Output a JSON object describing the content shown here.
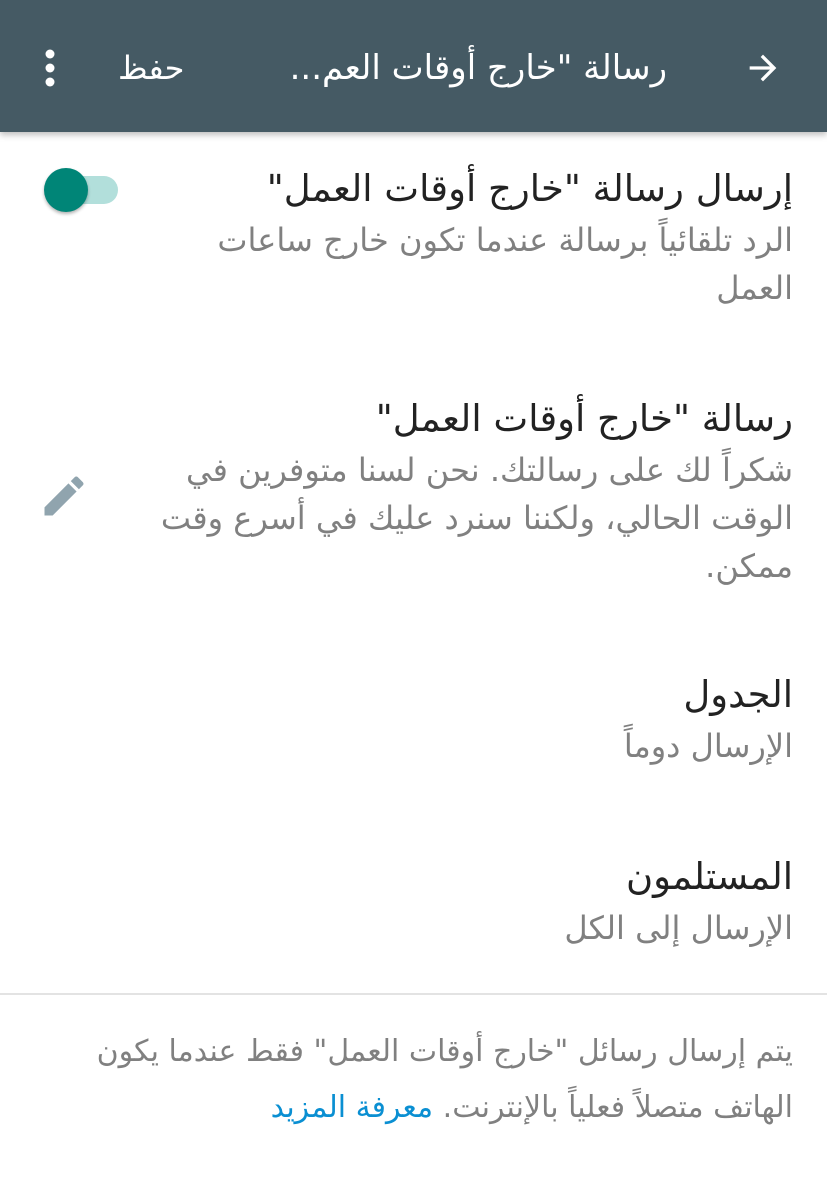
{
  "appbar": {
    "title": "رسالة \"خارج أوقات العم...",
    "save_label": "حفظ",
    "back_icon": "arrow-right-icon",
    "menu_icon": "more-vert-icon",
    "background": "#455a64"
  },
  "auto_reply": {
    "title": "إرسال رسالة \"خارج أوقات العمل\"",
    "description": "الرد تلقائياً برسالة عندما تكون خارج ساعات العمل",
    "enabled": true,
    "accent": "#008577"
  },
  "message": {
    "title": "رسالة \"خارج أوقات العمل\"",
    "text": "شكراً لك على رسالتك. نحن لسنا متوفرين في الوقت الحالي، ولكننا سنرد عليك في أسرع وقت ممكن.",
    "edit_icon": "pencil-icon"
  },
  "schedule": {
    "title": "الجدول",
    "value": "الإرسال دوماً"
  },
  "recipients": {
    "title": "المستلمون",
    "value": "الإرسال إلى الكل"
  },
  "footer": {
    "note": "يتم إرسال رسائل \"خارج أوقات العمل\" فقط عندما يكون الهاتف متصلاً فعلياً بالإنترنت.",
    "learn_more": "معرفة المزيد",
    "link_color": "#0a8fd2"
  }
}
